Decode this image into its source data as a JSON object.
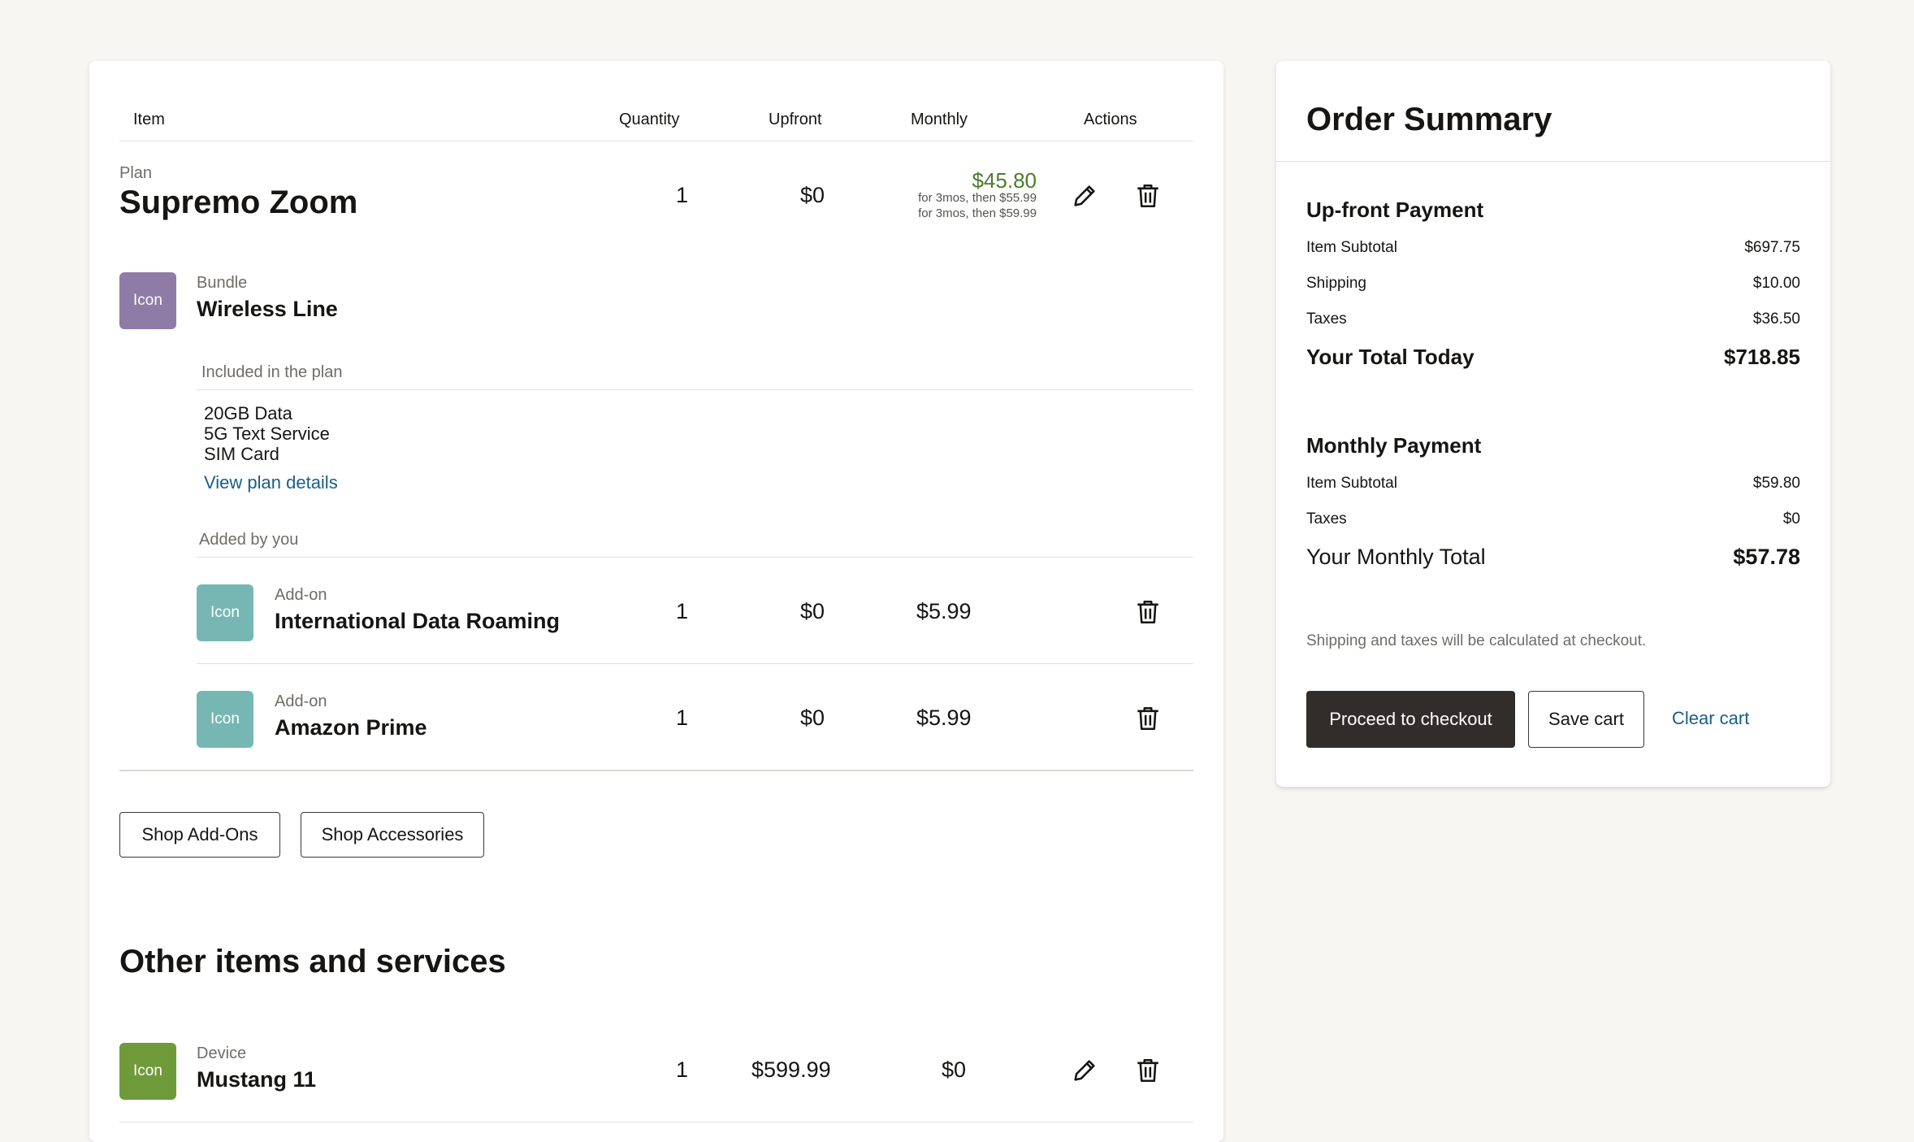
{
  "cart": {
    "columns": {
      "item": "Item",
      "quantity": "Quantity",
      "upfront": "Upfront",
      "monthly": "Monthly",
      "actions": "Actions"
    },
    "plan": {
      "category": "Plan",
      "name": "Supremo Zoom",
      "quantity": "1",
      "upfront": "$0",
      "monthly": "$45.80",
      "monthly_note_1": "for 3mos, then $55.99",
      "monthly_note_2": "for 3mos, then $59.99"
    },
    "bundle": {
      "icon_label": "Icon",
      "icon_color": "#8e7ba6",
      "category": "Bundle",
      "name": "Wireless Line",
      "included_heading": "Included in the plan",
      "included_items": [
        "20GB Data",
        "5G Text Service",
        "SIM Card"
      ],
      "view_details": "View plan details",
      "added_heading": "Added by you"
    },
    "addons": [
      {
        "icon_label": "Icon",
        "icon_color": "#77b7b3",
        "category": "Add-on",
        "name": "International Data Roaming",
        "quantity": "1",
        "upfront": "$0",
        "monthly": "$5.99"
      },
      {
        "icon_label": "Icon",
        "icon_color": "#77b7b3",
        "category": "Add-on",
        "name": "Amazon Prime",
        "quantity": "1",
        "upfront": "$0",
        "monthly": "$5.99"
      }
    ],
    "shop_addons": "Shop Add-Ons",
    "shop_accessories": "Shop Accessories",
    "other_heading": "Other items and services",
    "device": {
      "icon_label": "Icon",
      "icon_color": "#6e9a3a",
      "category": "Device",
      "name": "Mustang 11",
      "quantity": "1",
      "upfront": "$599.99",
      "monthly": "$0"
    },
    "accent_green": "#4c7d2c"
  },
  "summary": {
    "title": "Order Summary",
    "upfront": {
      "heading": "Up-front Payment",
      "item_subtotal_label": "Item Subtotal",
      "item_subtotal": "$697.75",
      "shipping_label": "Shipping",
      "shipping": "$10.00",
      "taxes_label": "Taxes",
      "taxes": "$36.50",
      "total_label": "Your Total Today",
      "total": "$718.85"
    },
    "monthly": {
      "heading": "Monthly Payment",
      "item_subtotal_label": "Item Subtotal",
      "item_subtotal": "$59.80",
      "taxes_label": "Taxes",
      "taxes": "$0",
      "total_label": "Your Monthly Total",
      "total": "$57.78"
    },
    "note": "Shipping and taxes will be calculated at checkout.",
    "checkout_button": "Proceed to checkout",
    "save_button": "Save cart",
    "clear_link": "Clear cart",
    "checkout_color": "#312d2a"
  }
}
